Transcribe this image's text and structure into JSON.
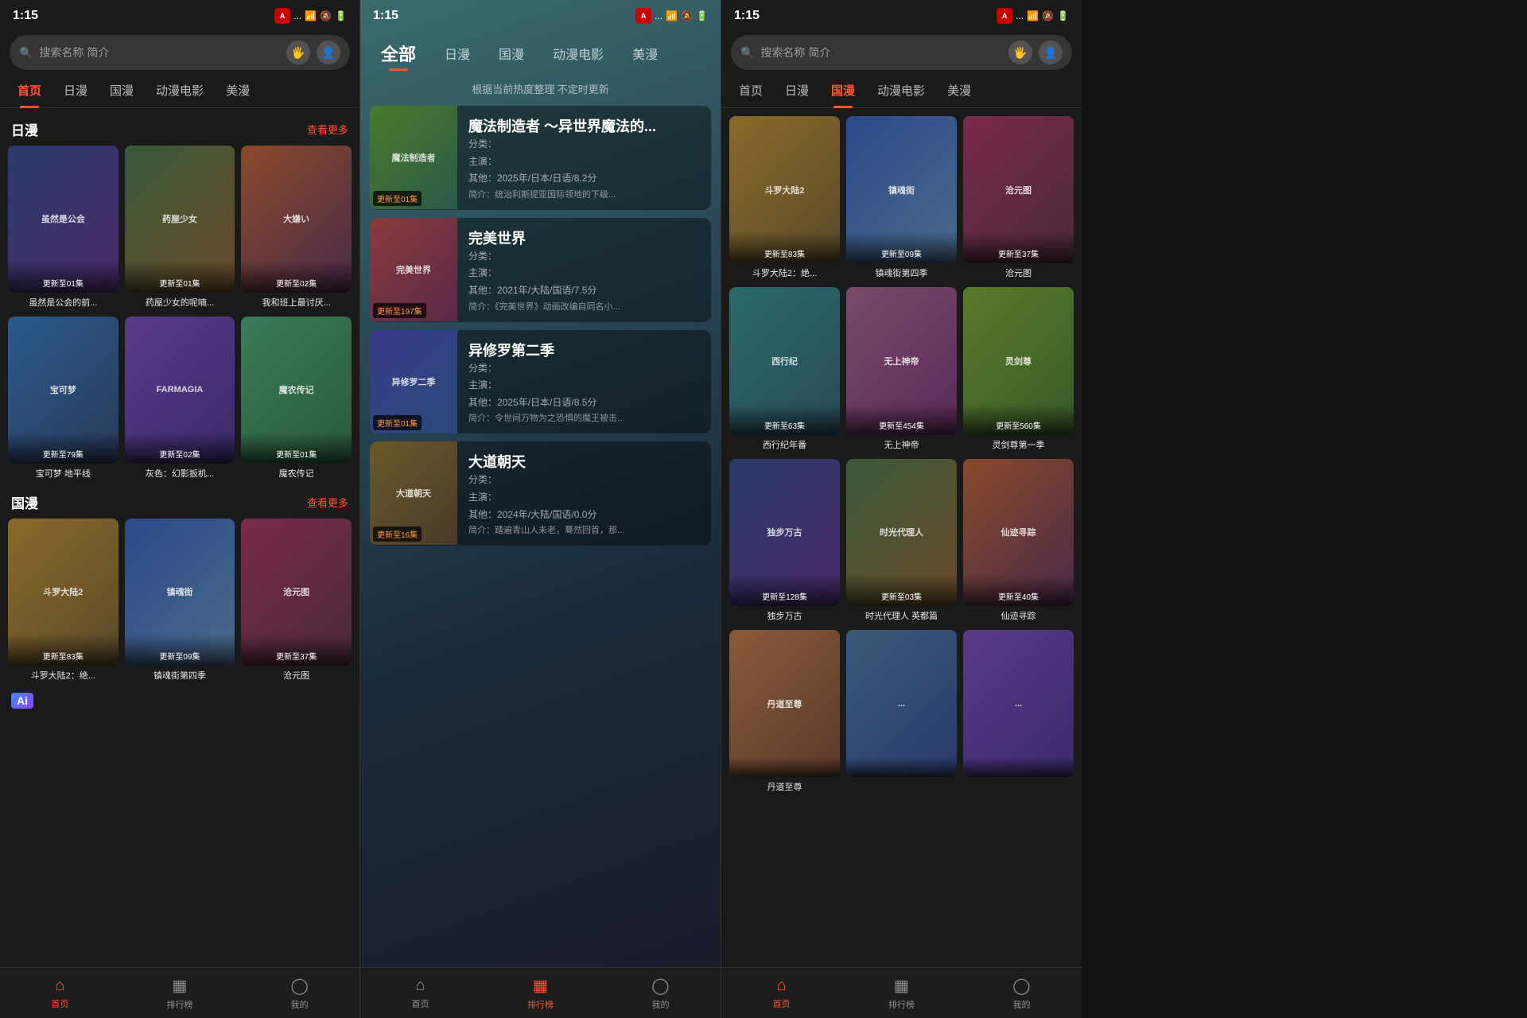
{
  "panels": [
    {
      "id": "left",
      "statusBar": {
        "time": "1:15",
        "appIcon": "A",
        "dots": "..."
      },
      "search": {
        "placeholder": "搜索名称 简介"
      },
      "navTabs": [
        {
          "label": "首页",
          "active": true
        },
        {
          "label": "日漫",
          "active": false
        },
        {
          "label": "国漫",
          "active": false
        },
        {
          "label": "动漫电影",
          "active": false
        },
        {
          "label": "美漫",
          "active": false
        }
      ],
      "sections": [
        {
          "title": "日漫",
          "more": "查看更多",
          "items": [
            {
              "title": "虽然是公会的前...",
              "badge": "更新至01集",
              "color": "c1"
            },
            {
              "title": "药屋少女的呢喃...",
              "badge": "更新至01集",
              "color": "c2"
            },
            {
              "title": "我和班上最讨厌...",
              "badge": "更新至02集",
              "color": "c3"
            },
            {
              "title": "宝可梦 地平线",
              "badge": "更新至79集",
              "color": "c4"
            },
            {
              "title": "灰色：幻影扳机...",
              "badge": "更新至02集",
              "color": "c5"
            },
            {
              "title": "魔农传记",
              "badge": "更新至01集",
              "color": "c6"
            }
          ]
        },
        {
          "title": "国漫",
          "more": "查看更多",
          "items": [
            {
              "title": "斗罗大陆2：绝...",
              "badge": "更新至83集",
              "color": "c7"
            },
            {
              "title": "镇魂街第四季",
              "badge": "更新至09集",
              "color": "c8"
            },
            {
              "title": "沧元图",
              "badge": "更新至37集",
              "color": "c9"
            }
          ]
        }
      ],
      "bottomNav": [
        {
          "label": "首页",
          "icon": "⌂",
          "active": true
        },
        {
          "label": "排行榜",
          "icon": "▦",
          "active": false
        },
        {
          "label": "我的",
          "icon": "◯",
          "active": false
        }
      ]
    },
    {
      "id": "middle",
      "statusBar": {
        "time": "1:15",
        "appIcon": "A",
        "dots": "..."
      },
      "search": null,
      "navTabs": [
        {
          "label": "全部",
          "active": true
        },
        {
          "label": "日漫",
          "active": false
        },
        {
          "label": "国漫",
          "active": false
        },
        {
          "label": "动漫电影",
          "active": false
        },
        {
          "label": "美漫",
          "active": false
        }
      ],
      "subtitle": "根据当前热度整理 不定时更新",
      "rankings": [
        {
          "title": "魔法制造者 ～异世界魔法的...",
          "category": "分类：",
          "cast": "主演：",
          "info": "其他：2025年/日本/日语/8.2分",
          "badge": "更新至01集",
          "desc": "简介：统治利斯提亚国际领地的下级...",
          "color": "c10"
        },
        {
          "title": "完美世界",
          "category": "分类：",
          "cast": "主演：",
          "info": "其他：2021年/大陆/国语/7.5分",
          "badge": "更新至197集",
          "desc": "简介：《完美世界》动画改编自同名小...",
          "color": "c11"
        },
        {
          "title": "异修罗第二季",
          "category": "分类：",
          "cast": "主演：",
          "info": "其他：2025年/日本/日语/8.5分",
          "badge": "更新至01集",
          "desc": "简介：令世间万物为之恐惧的魔王被击...",
          "color": "c12"
        },
        {
          "title": "大道朝天",
          "category": "分类：",
          "cast": "主演：",
          "info": "其他：2024年/大陆/国语/0.0分",
          "badge": "更新至16集",
          "desc": "简介：踏遍青山人未老，蓦然回首，那...",
          "color": "c13"
        }
      ],
      "bottomNav": [
        {
          "label": "首页",
          "icon": "⌂",
          "active": false
        },
        {
          "label": "排行榜",
          "icon": "▦",
          "active": true
        },
        {
          "label": "我的",
          "icon": "◯",
          "active": false
        }
      ]
    },
    {
      "id": "right",
      "statusBar": {
        "time": "1:15",
        "appIcon": "A",
        "dots": "..."
      },
      "search": {
        "placeholder": "搜索名称 简介"
      },
      "navTabs": [
        {
          "label": "首页",
          "active": false
        },
        {
          "label": "日漫",
          "active": false
        },
        {
          "label": "国漫",
          "active": true
        },
        {
          "label": "动漫电影",
          "active": false
        },
        {
          "label": "美漫",
          "active": false
        }
      ],
      "animeItems": [
        {
          "title": "斗罗大陆2：绝...",
          "badge": "更新至83集",
          "color": "c7"
        },
        {
          "title": "镇魂街第四季",
          "badge": "更新至09集",
          "color": "c8"
        },
        {
          "title": "沧元图",
          "badge": "更新至37集",
          "color": "c9"
        },
        {
          "title": "西行纪年番",
          "badge": "更新至63集",
          "color": "c14"
        },
        {
          "title": "无上神帝",
          "badge": "更新至454集",
          "color": "c15"
        },
        {
          "title": "灵剑尊第一季",
          "badge": "更新至560集",
          "color": "c16"
        },
        {
          "title": "独步万古",
          "badge": "更新至128集",
          "color": "c1"
        },
        {
          "title": "时光代理人 英都篇",
          "badge": "更新至03集",
          "color": "c2"
        },
        {
          "title": "仙迹寻踪",
          "badge": "更新至40集",
          "color": "c3"
        },
        {
          "title": "丹道至尊",
          "badge": "",
          "color": "c17"
        },
        {
          "title": "...",
          "badge": "",
          "color": "c18"
        },
        {
          "title": "...",
          "badge": "",
          "color": "c5"
        }
      ],
      "bottomNav": [
        {
          "label": "首页",
          "icon": "⌂",
          "active": true
        },
        {
          "label": "排行榜",
          "icon": "▦",
          "active": false
        },
        {
          "label": "我的",
          "icon": "◯",
          "active": false
        }
      ]
    }
  ],
  "aiBadgeText": "Ai"
}
